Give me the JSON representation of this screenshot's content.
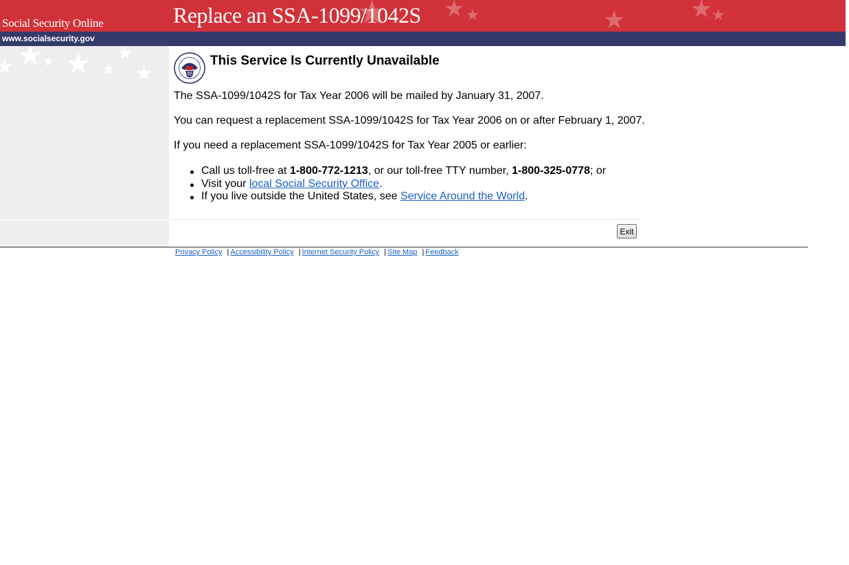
{
  "header": {
    "site_name": "Social Security Online",
    "page_heading": "Replace an SSA-1099/1042S",
    "url_text": "www.socialsecurity.gov",
    "banner_color": "#d13239",
    "urlbar_color": "#353a6b"
  },
  "content": {
    "seal_icon": "ssa-seal-icon",
    "title": "This Service Is Currently Unavailable",
    "paragraphs": [
      "The SSA-1099/1042S for Tax Year 2006 will be mailed by January 31, 2007.",
      "You can request a replacement SSA-1099/1042S for Tax Year 2006 on or after February 1, 2007.",
      "If you need a replacement SSA-1099/1042S for Tax Year 2005 or earlier:"
    ],
    "bullets": {
      "call": {
        "prefix": "Call us toll-free at ",
        "phone1": "1-800-772-1213",
        "middle": ", or our toll-free TTY number, ",
        "phone2": "1-800-325-0778",
        "suffix": "; or"
      },
      "visit": {
        "prefix": "Visit your ",
        "link": "local Social Security Office",
        "suffix": "."
      },
      "outside": {
        "prefix": "If you live outside the United States, see ",
        "link": "Service Around the World",
        "suffix": "."
      }
    }
  },
  "actions": {
    "exit_label": "Exit"
  },
  "footer": {
    "links": [
      "Privacy Policy",
      "Accessibility Policy",
      "Internet Security Policy",
      "Site Map",
      "Feedback"
    ],
    "separator": "|",
    "link_color": "#1a5ec4"
  }
}
